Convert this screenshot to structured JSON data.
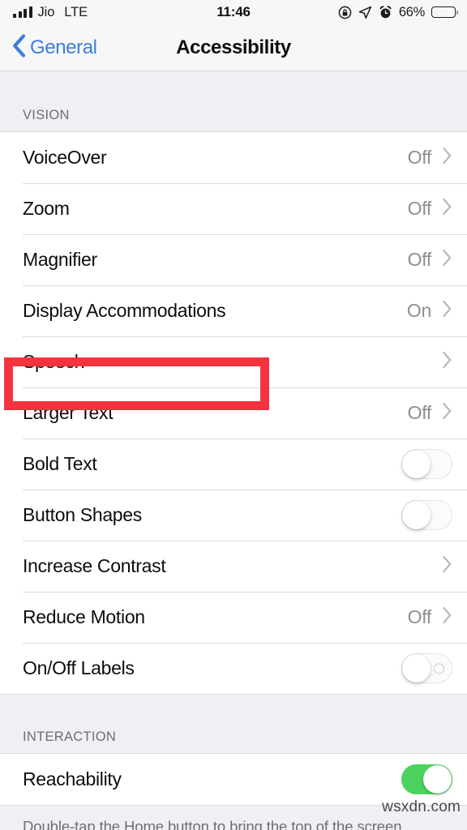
{
  "status_bar": {
    "carrier": "Jio",
    "network": "LTE",
    "time": "11:46",
    "battery_percent": "66%",
    "battery_level": 66,
    "icons": [
      "signal-bars-icon",
      "rotation-lock-icon",
      "location-arrow-icon",
      "alarm-clock-icon",
      "battery-icon"
    ]
  },
  "nav_bar": {
    "back_label": "General",
    "title": "Accessibility"
  },
  "sections": [
    {
      "header": "VISION",
      "rows": [
        {
          "label": "VoiceOver",
          "value": "Off",
          "control": "chevron"
        },
        {
          "label": "Zoom",
          "value": "Off",
          "control": "chevron"
        },
        {
          "label": "Magnifier",
          "value": "Off",
          "control": "chevron"
        },
        {
          "label": "Display Accommodations",
          "value": "On",
          "control": "chevron",
          "highlighted": true
        },
        {
          "label": "Speech",
          "value": "",
          "control": "chevron"
        },
        {
          "label": "Larger Text",
          "value": "Off",
          "control": "chevron"
        },
        {
          "label": "Bold Text",
          "value": "",
          "control": "toggle",
          "toggle_state": "off"
        },
        {
          "label": "Button Shapes",
          "value": "",
          "control": "toggle",
          "toggle_state": "off"
        },
        {
          "label": "Increase Contrast",
          "value": "",
          "control": "chevron"
        },
        {
          "label": "Reduce Motion",
          "value": "Off",
          "control": "chevron"
        },
        {
          "label": "On/Off Labels",
          "value": "",
          "control": "toggle",
          "toggle_state": "off",
          "has_o_label": true
        }
      ]
    },
    {
      "header": "INTERACTION",
      "rows": [
        {
          "label": "Reachability",
          "value": "",
          "control": "toggle",
          "toggle_state": "on"
        }
      ],
      "footer": "Double-tap the Home button to bring the top of the screen"
    }
  ],
  "watermark": "wsxdn.com",
  "colors": {
    "accent_blue": "#3b7ede",
    "toggle_on_green": "#4cd35f",
    "annotation_red": "#f5333f",
    "group_background": "#efeff4",
    "row_background": "#ffffff",
    "secondary_text": "#8e8e93"
  }
}
